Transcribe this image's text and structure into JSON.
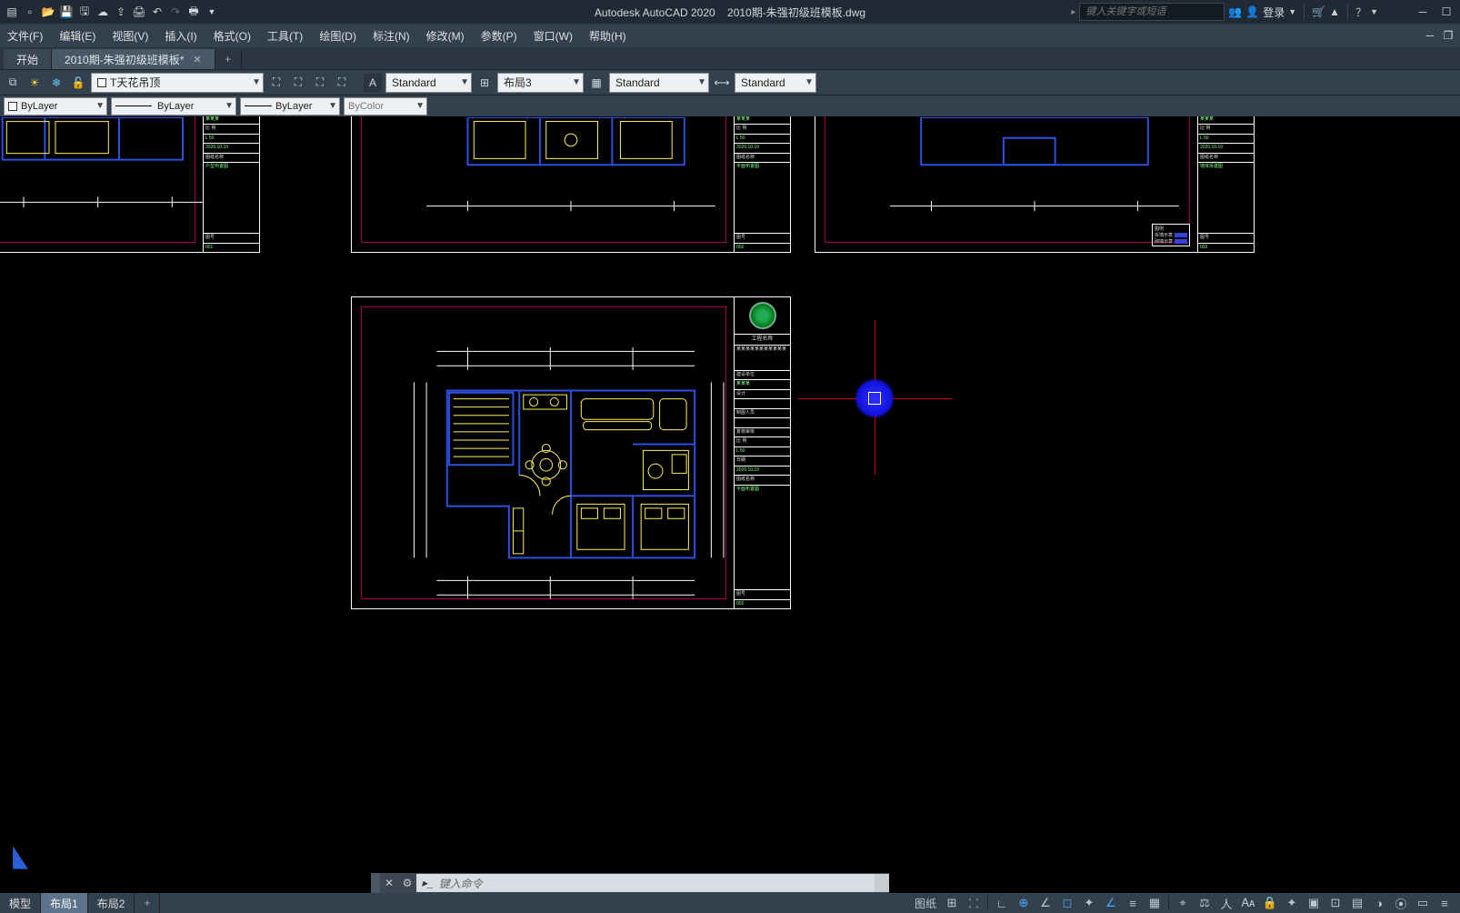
{
  "app": {
    "name": "Autodesk AutoCAD 2020",
    "doc": "2010期-朱强初级班模板.dwg"
  },
  "titlebar": {
    "search_placeholder": "键入关键字或短语",
    "login": "登录"
  },
  "menu": {
    "file": "文件(F)",
    "edit": "编辑(E)",
    "view": "视图(V)",
    "insert": "插入(I)",
    "format": "格式(O)",
    "tools": "工具(T)",
    "draw": "绘图(D)",
    "dimension": "标注(N)",
    "modify": "修改(M)",
    "parametric": "参数(P)",
    "window": "窗口(W)",
    "help": "帮助(H)"
  },
  "tabs": {
    "start": "开始",
    "doc": "2010期-朱强初级班模板*",
    "new": "+"
  },
  "layers": {
    "current": "T天花吊顶"
  },
  "styles": {
    "textstyle": "Standard",
    "layout": "布局3",
    "tablestyle": "Standard",
    "dimstyle": "Standard"
  },
  "props": {
    "color": "ByLayer",
    "lineweight": "ByLayer",
    "linetype": "ByLayer",
    "bycolor": "ByColor"
  },
  "cmd": {
    "placeholder": "键入命令"
  },
  "status": {
    "model": "模型",
    "layout1": "布局1",
    "layout2": "布局2",
    "add": "+",
    "paper": "图纸"
  },
  "titleblock": {
    "header": "工程名称",
    "desc1": "某某某某某某某某某某某",
    "r_client": "建设单位",
    "v_client": "某某某",
    "r_designer": "设计",
    "r_drafter": "制图人员",
    "r_checker": "复核审核",
    "r_scale": "比  例",
    "v_scale": "L  50",
    "r_date": "日期",
    "v_date": "2020.10.19",
    "r_dwgname": "图纸名称",
    "v_dwgname1": "户型布置图",
    "v_dwgname2": "平面布置图",
    "v_dwgname3": "墙体拆建图",
    "r_dwgno": "图号",
    "v_no1": "001",
    "v_no2": "002",
    "v_no3": "003",
    "legend": "图例",
    "leg1": "拆墙示意",
    "leg2": "砌墙示意"
  }
}
